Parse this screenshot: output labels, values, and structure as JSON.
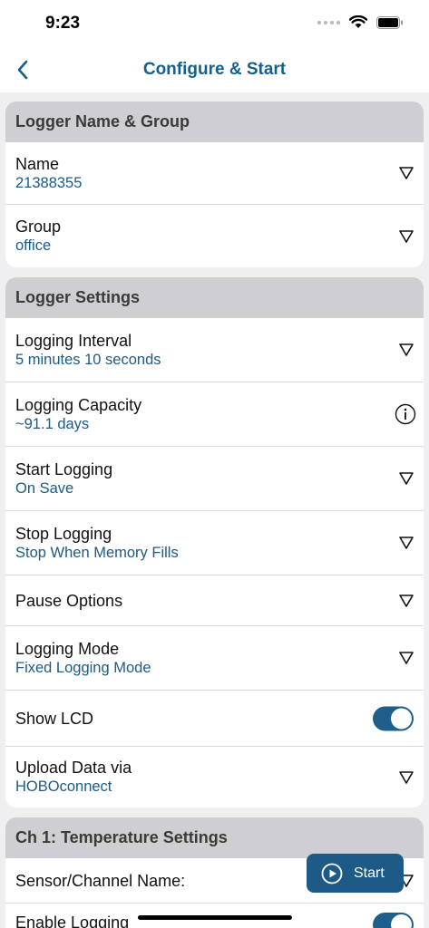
{
  "status": {
    "time": "9:23"
  },
  "nav": {
    "title": "Configure & Start",
    "back_icon": "chevron-left-icon"
  },
  "sections": {
    "name_group": {
      "header": "Logger Name & Group",
      "name_label": "Name",
      "name_value": "21388355",
      "group_label": "Group",
      "group_value": "office"
    },
    "settings": {
      "header": "Logger Settings",
      "interval_label": "Logging Interval",
      "interval_value": "5 minutes 10 seconds",
      "capacity_label": "Logging Capacity",
      "capacity_value": "~91.1 days",
      "start_label": "Start Logging",
      "start_value": "On Save",
      "stop_label": "Stop Logging",
      "stop_value": "Stop When Memory Fills",
      "pause_label": "Pause Options",
      "mode_label": "Logging Mode",
      "mode_value": "Fixed Logging Mode",
      "lcd_label": "Show LCD",
      "lcd_on": true,
      "upload_label": "Upload Data via",
      "upload_value": "HOBOconnect"
    },
    "ch1": {
      "header": "Ch 1: Temperature Settings",
      "sensor_label": "Sensor/Channel Name:",
      "enable_label": "Enable Logging"
    }
  },
  "start_button": {
    "label": "Start",
    "icon": "play-circle-icon"
  },
  "colors": {
    "accent": "#1d5a85",
    "title": "#155f8c",
    "header_bg": "#cfcfd3",
    "page_bg": "#efeff1"
  }
}
